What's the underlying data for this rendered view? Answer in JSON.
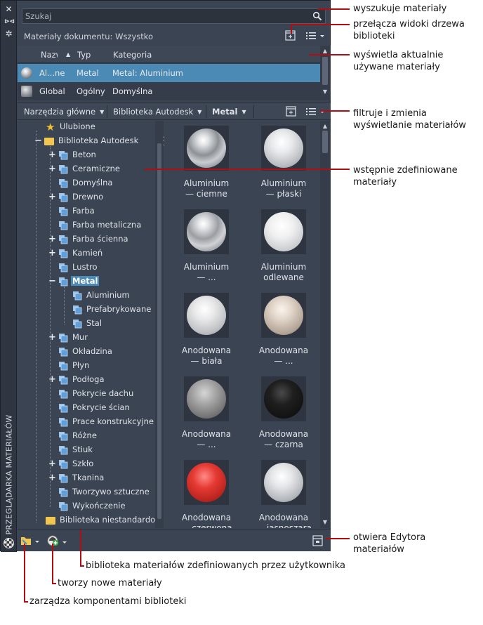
{
  "search": {
    "placeholder": "Szukaj"
  },
  "palette_title": "PRZEGLĄDARKA MATERIAŁÓW",
  "doc_materials": {
    "label": "Materiały dokumentu: Wszystko"
  },
  "doc_table": {
    "columns": [
      "Nazwa",
      "Typ",
      "Kategoria"
    ],
    "rows": [
      {
        "name": "Al...ne",
        "type": "Metal",
        "category": "Metal: Aluminium",
        "selected": true
      },
      {
        "name": "Global",
        "type": "Ogólny",
        "category": "Domyślna",
        "selected": false
      }
    ]
  },
  "lib_toolbar": {
    "home_tools": "Narzędzia główne",
    "library": "Biblioteka Autodesk",
    "category": "Metal"
  },
  "tree": {
    "favorites": "Ulubione",
    "autodesk_library": "Biblioteka Autodesk",
    "items": [
      "Beton",
      "Ceramiczne",
      "Domyślna",
      "Drewno",
      "Farba",
      "Farba metaliczna",
      "Farba ścienna",
      "Kamień",
      "Lustro",
      "Metal",
      "Aluminium",
      "Prefabrykowane",
      "Stal",
      "Mur",
      "Okładzina",
      "Płyn",
      "Podłoga",
      "Pokrycie dachu",
      "Pokrycie ścian",
      "Prace konstrukcyjne",
      "Różne",
      "Stiuk",
      "Szkło",
      "Tkanina",
      "Tworzywo sztuczne",
      "Wykończenie"
    ],
    "user_library": "Biblioteka niestandardo"
  },
  "grid": [
    {
      "line1": "Aluminium",
      "line2": "— ciemne"
    },
    {
      "line1": "Aluminium",
      "line2": "— płaski"
    },
    {
      "line1": "Aluminium",
      "line2": "— ..."
    },
    {
      "line1": "Aluminium",
      "line2": "odlewane"
    },
    {
      "line1": "Anodowana",
      "line2": "— biała"
    },
    {
      "line1": "Anodowana",
      "line2": "— ..."
    },
    {
      "line1": "Anodowana",
      "line2": "— ..."
    },
    {
      "line1": "Anodowana",
      "line2": "— czarna"
    },
    {
      "line1": "Anodowana",
      "line2": "— czerwona"
    },
    {
      "line1": "Anodowana",
      "line2": "— jasnoszara"
    }
  ],
  "annotations": {
    "search": "wyszukuje materiały",
    "switch_views": "przełącza widoki drzewa biblioteki",
    "shows_used": "wyświetla aktualnie używane materiały",
    "filters": "filtruje i zmienia wyświetlanie materiałów",
    "predefined": "wstępnie zdefiniowane materiały",
    "opens_editor": "otwiera Edytora materiałów",
    "user_library": "biblioteka materiałów zdefiniowanych przez użytkownika",
    "creates_new": "tworzy nowe materiały",
    "manages": "zarządza komponentami biblioteki"
  },
  "colors": {
    "selection": "#4b8ab4",
    "callout": "#b30d12",
    "panel": "#3b4453"
  }
}
